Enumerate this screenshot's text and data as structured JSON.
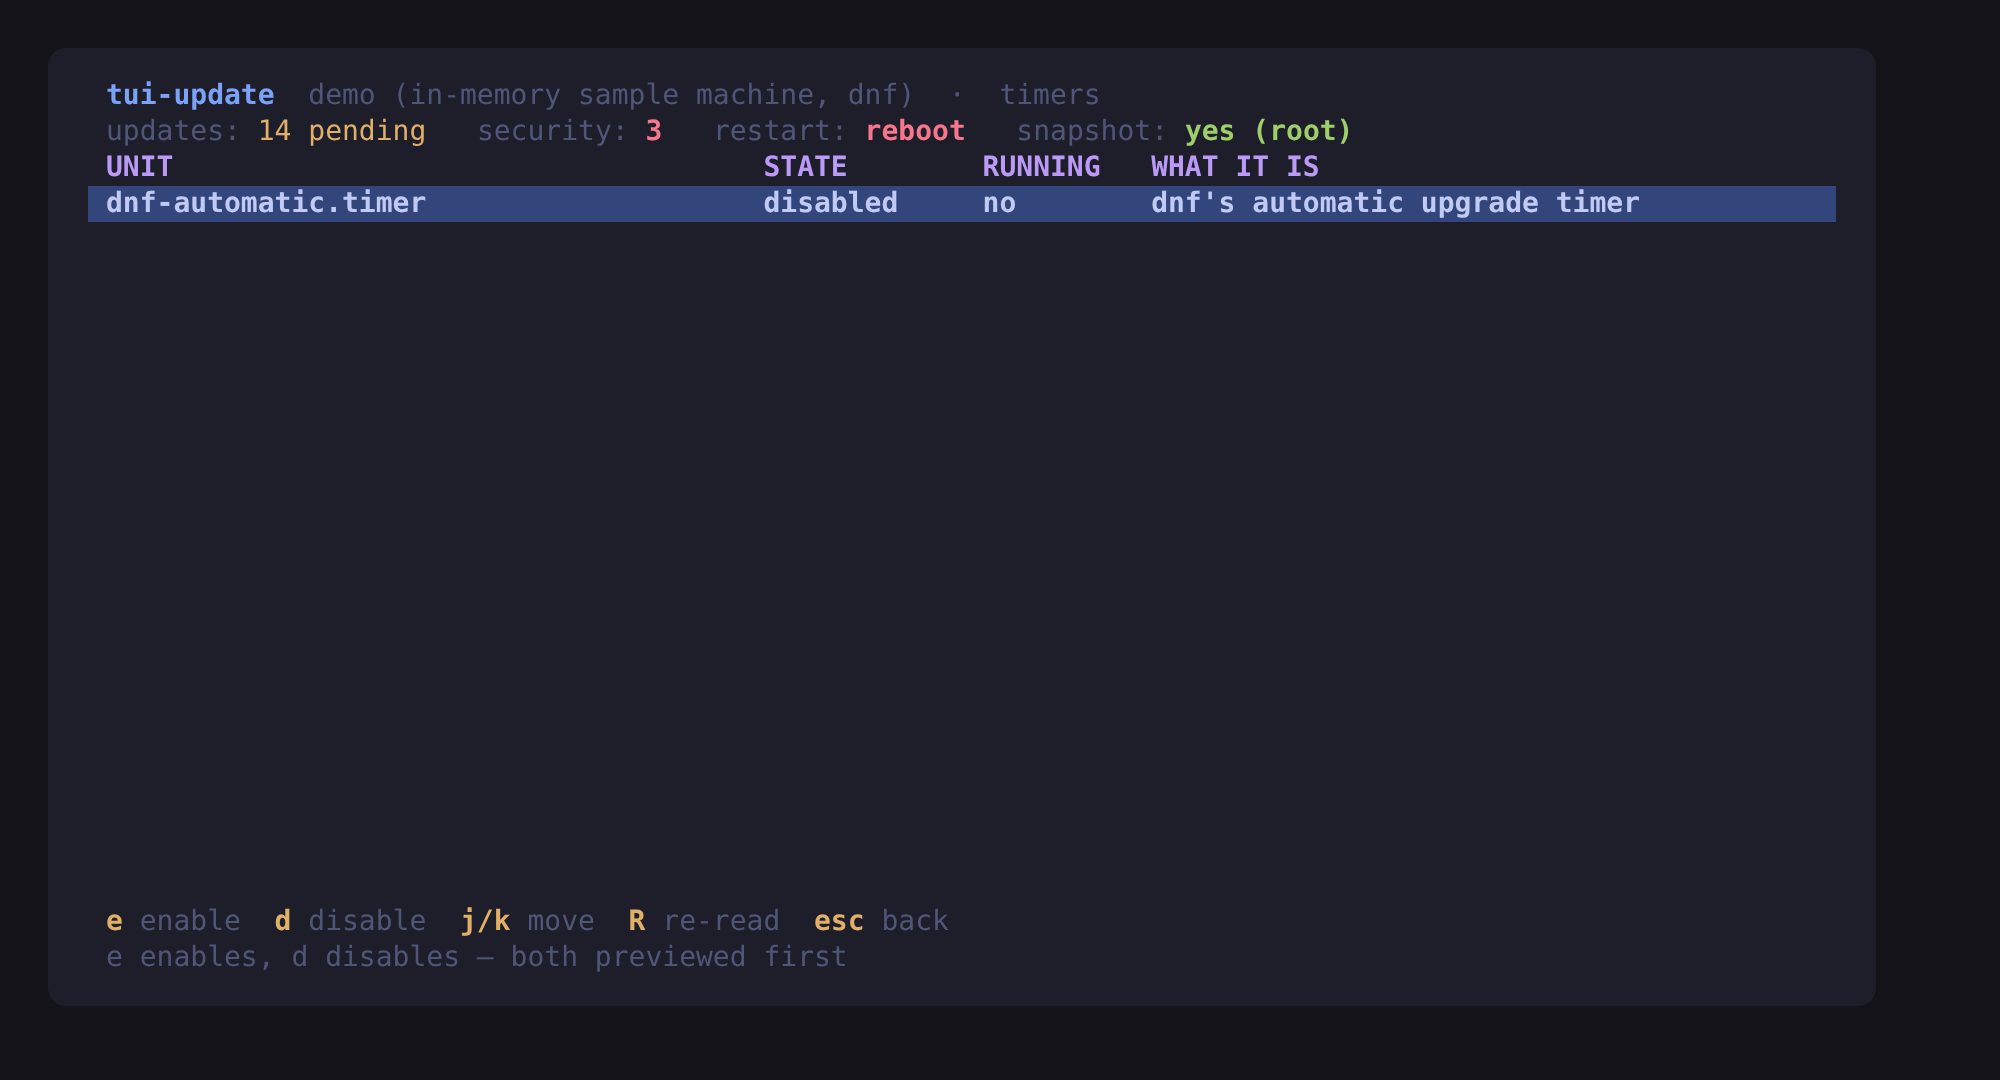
{
  "header": {
    "app": "tui-update",
    "context": "demo (in-memory sample machine, dnf)",
    "separator": "·",
    "view": "timers"
  },
  "status": [
    {
      "label": "updates:",
      "value": "14 pending",
      "kind": "warning"
    },
    {
      "label": "security:",
      "value": "3",
      "kind": "danger"
    },
    {
      "label": "restart:",
      "value": "reboot",
      "kind": "danger"
    },
    {
      "label": "snapshot:",
      "value": "yes (root)",
      "kind": "success"
    }
  ],
  "table": {
    "columns": [
      "UNIT",
      "STATE",
      "RUNNING",
      "WHAT IT IS"
    ],
    "rows": [
      {
        "cells": [
          "dnf-automatic.timer",
          "disabled",
          "no",
          "dnf's automatic upgrade timer"
        ],
        "selected": true
      }
    ]
  },
  "footer": {
    "keys": [
      {
        "key": "e",
        "action": "enable"
      },
      {
        "key": "d",
        "action": "disable"
      },
      {
        "key": "j/k",
        "action": "move"
      },
      {
        "key": "R",
        "action": "re-read"
      },
      {
        "key": "esc",
        "action": "back"
      }
    ],
    "hint": "e enables, d disables — both previewed first"
  }
}
